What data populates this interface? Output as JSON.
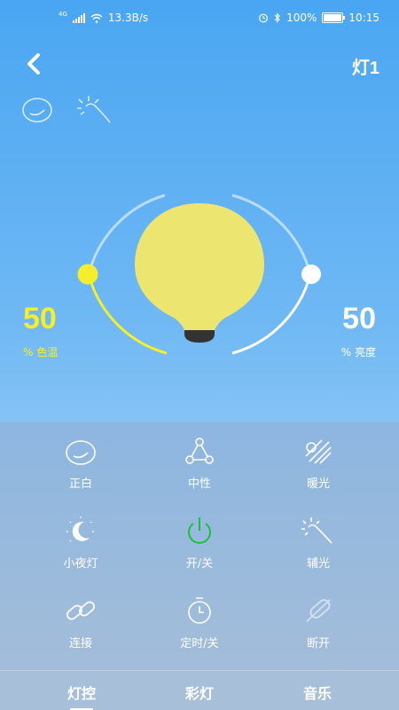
{
  "status_bar": {
    "net_badge": "4G",
    "speed": "13.3B/s",
    "battery": "100%",
    "time": "10:15",
    "icons": [
      "signal-icon",
      "wifi-icon",
      "alarm-icon",
      "bluetooth-icon",
      "battery-icon"
    ]
  },
  "header": {
    "title": "灯1",
    "back_icon": "chevron-left-icon"
  },
  "mode_icons": [
    "moon-crescent-icon",
    "sun-rays-icon"
  ],
  "dial": {
    "color_temp_value": "50",
    "color_temp_label": "% 色温",
    "brightness_value": "50",
    "brightness_label": "% 亮度",
    "color_temp_level": 0.5,
    "brightness_level": 0.5,
    "colors": {
      "left_arc": "#f5ef2b",
      "right_arc": "#ffffff",
      "bulb": "#ece56f"
    }
  },
  "controls": [
    {
      "label": "正白",
      "icon": "white-light-icon"
    },
    {
      "label": "中性",
      "icon": "neutral-triangle-icon"
    },
    {
      "label": "暖光",
      "icon": "warm-light-icon"
    },
    {
      "label": "小夜灯",
      "icon": "night-light-icon"
    },
    {
      "label": "开/关",
      "icon": "power-icon"
    },
    {
      "label": "辅光",
      "icon": "aux-light-icon"
    },
    {
      "label": "连接",
      "icon": "link-icon"
    },
    {
      "label": "定时/关",
      "icon": "timer-icon"
    },
    {
      "label": "断开",
      "icon": "disconnect-icon"
    }
  ],
  "tabs": [
    {
      "label": "灯控",
      "active": true
    },
    {
      "label": "彩灯",
      "active": false
    },
    {
      "label": "音乐",
      "active": false
    }
  ],
  "colors": {
    "power_on": "#18c23a",
    "accent_text": "#f5ef2b"
  }
}
